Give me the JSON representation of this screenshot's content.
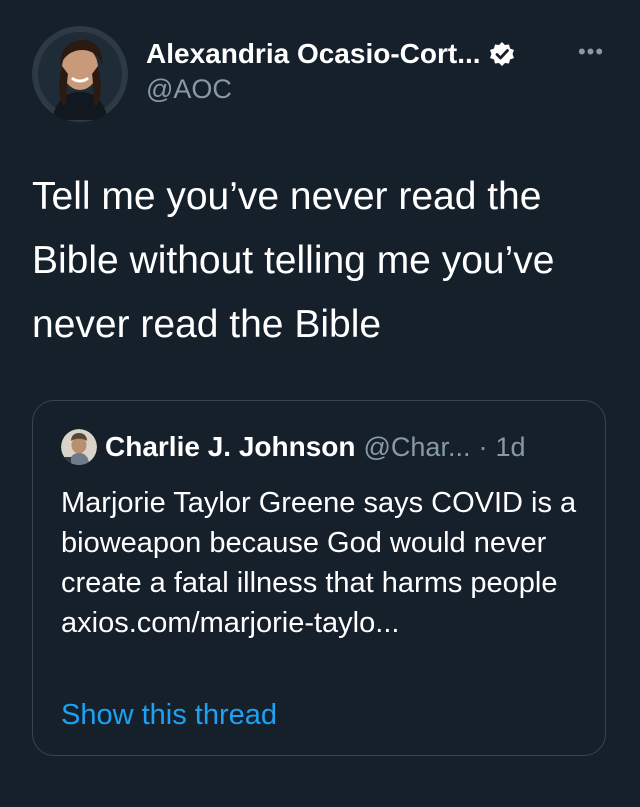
{
  "tweet": {
    "author": {
      "display_name": "Alexandria Ocasio-Cort...",
      "handle": "@AOC",
      "avatar": "avatar-photo-icon",
      "verified_icon": "verified-badge-icon"
    },
    "more_icon": "more-options-icon",
    "text": "Tell me you’ve never read the Bible without telling me you’ve never read the Bible"
  },
  "quoted_tweet": {
    "author": {
      "display_name": "Charlie J. Johnson",
      "handle": "@Char...",
      "avatar": "avatar-photo-icon"
    },
    "separator": "·",
    "time": "1d",
    "text": "Marjorie Taylor Greene says COVID is a bioweapon because God would never create a fatal illness that harms people  axios.com/marjorie-taylo...",
    "show_thread_label": "Show this thread"
  },
  "colors": {
    "background": "#15202b",
    "text_primary": "#ffffff",
    "text_secondary": "#8899a6",
    "link": "#1da1f2",
    "border": "#38444d"
  }
}
